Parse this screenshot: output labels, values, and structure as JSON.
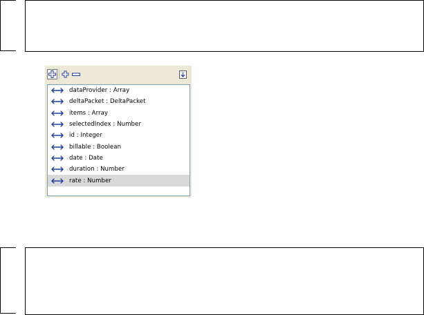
{
  "toolbar": {
    "add_button_icon": "plus-box-icon",
    "add_child_icon": "plus-small-icon",
    "remove_icon": "minus-icon",
    "import_icon": "arrow-down-icon"
  },
  "colors": {
    "icon_blue": "#1f3fa0",
    "selection": "#d9d9d9",
    "panel_bg": "#ece9d8",
    "list_border": "#7f9db9"
  },
  "bindings": {
    "items": [
      {
        "label": "dataProvider : Array",
        "icon": "bidirectional-arrow-icon"
      },
      {
        "label": "deltaPacket : DeltaPacket",
        "icon": "bidirectional-arrow-icon"
      },
      {
        "label": "items : Array",
        "icon": "bidirectional-arrow-icon"
      },
      {
        "label": "selectedIndex : Number",
        "icon": "bidirectional-arrow-icon"
      },
      {
        "label": "id : Integer",
        "icon": "bidirectional-arrow-icon"
      },
      {
        "label": "billable : Boolean",
        "icon": "bidirectional-arrow-icon"
      },
      {
        "label": "date : Date",
        "icon": "bidirectional-arrow-icon"
      },
      {
        "label": "duration : Number",
        "icon": "bidirectional-arrow-icon"
      },
      {
        "label": "rate : Number",
        "icon": "bidirectional-arrow-icon",
        "selected": true
      }
    ]
  }
}
